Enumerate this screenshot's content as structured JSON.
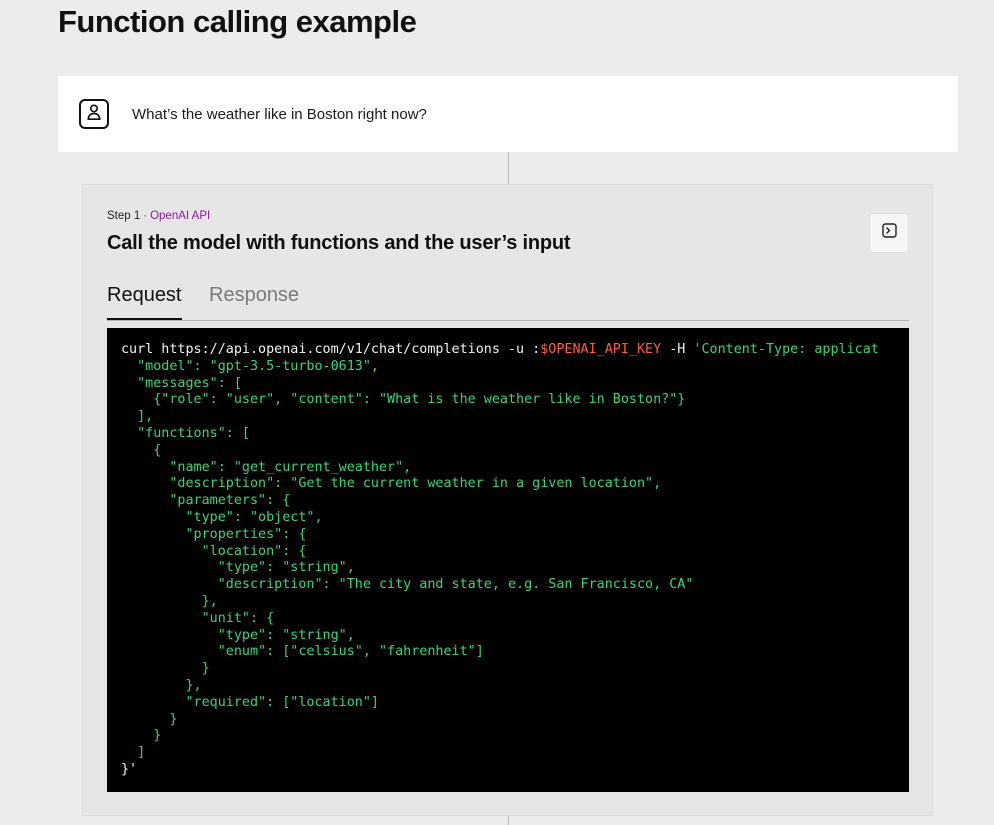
{
  "page": {
    "title": "Function calling example"
  },
  "user_message": {
    "text": "What’s the weather like in Boston right now?",
    "avatar_icon": "user-icon"
  },
  "step": {
    "label": "Step 1",
    "separator": "·",
    "api": "OpenAI API",
    "title": "Call the model with functions and the user’s input",
    "terminal_icon": "terminal-icon"
  },
  "tabs": [
    {
      "label": "Request",
      "active": true
    },
    {
      "label": "Response",
      "active": false
    }
  ],
  "code": {
    "command_prefix": "curl https://api.openai.com/v1/chat/completions -u :",
    "env_var": "$OPENAI_API_KEY",
    "header_flag": " -H ",
    "header_value": "'Content-Type: applicat",
    "body_lines": [
      "  \"model\": \"gpt-3.5-turbo-0613\",",
      "  \"messages\": [",
      "    {\"role\": \"user\", \"content\": \"What is the weather like in Boston?\"}",
      "  ],",
      "  \"functions\": [",
      "    {",
      "      \"name\": \"get_current_weather\",",
      "      \"description\": \"Get the current weather in a given location\",",
      "      \"parameters\": {",
      "        \"type\": \"object\",",
      "        \"properties\": {",
      "          \"location\": {",
      "            \"type\": \"string\",",
      "            \"description\": \"The city and state, e.g. San Francisco, CA\"",
      "          },",
      "          \"unit\": {",
      "            \"type\": \"string\",",
      "            \"enum\": [\"celsius\", \"fahrenheit\"]",
      "          }",
      "        },",
      "        \"required\": [\"location\"]",
      "      }",
      "    }",
      "  ]",
      "}'"
    ]
  },
  "colors": {
    "code_background": "#000000",
    "code_text": "#f2f2f2",
    "code_env_var": "#ff5c3a",
    "code_string": "#35d67a",
    "api_label": "#8a1b9b"
  }
}
